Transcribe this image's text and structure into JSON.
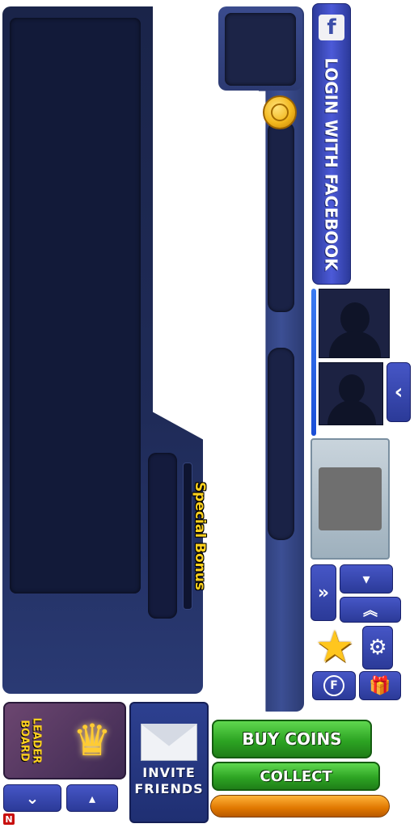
{
  "facebook": {
    "logo": "f",
    "label": "LOGIN WITH FACEBOOK"
  },
  "special_bonus": "Special Bonus",
  "leaderboard": {
    "label": "LEADER\nBOARD"
  },
  "invite": {
    "label": "INVITE\nFRIENDS"
  },
  "buy_coins": "BUY COINS",
  "collect": "COLLECT",
  "badge": "N",
  "icons": {
    "back": "‹",
    "fast_forward": "»",
    "down": "▾",
    "double_up": "︽",
    "star": "★",
    "gear": "⚙",
    "f_coin": "F",
    "gift": "🎁",
    "crown": "♛",
    "chevron_down": "⌄",
    "arrow_up": "▴"
  },
  "colors": {
    "panel": "#1f2b58",
    "gold": "#ffd21e",
    "green": "#2da423",
    "facebook_blue": "#3b4ea8",
    "orange": "#e07700"
  }
}
